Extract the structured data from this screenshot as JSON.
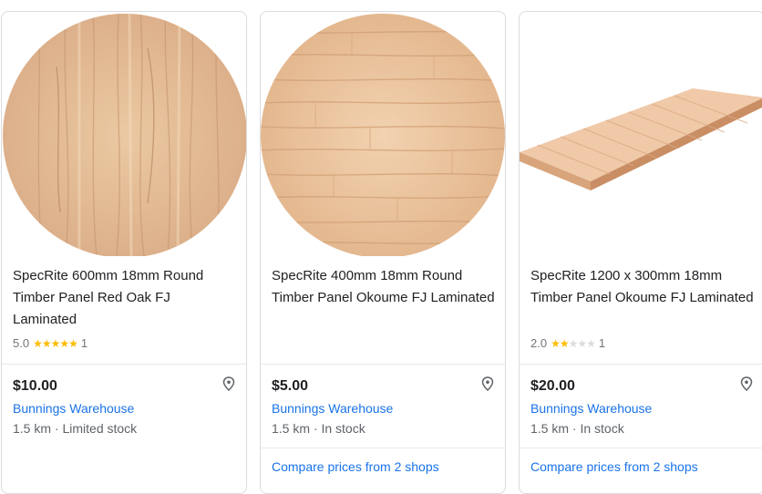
{
  "products": [
    {
      "title": "SpecRite 600mm 18mm Round Timber Panel Red Oak FJ Laminated",
      "rating": "5.0",
      "rating_value": 5,
      "review_count": "1",
      "price": "$10.00",
      "seller": "Bunnings Warehouse",
      "distance": "1.5 km",
      "stock": "Limited stock",
      "image_icon": "round-red-oak-panel"
    },
    {
      "title": "SpecRite 400mm 18mm Round Timber Panel Okoume FJ Laminated",
      "price": "$5.00",
      "seller": "Bunnings Warehouse",
      "distance": "1.5 km",
      "stock": "In stock",
      "compare": "Compare prices from 2 shops",
      "image_icon": "round-okoume-panel"
    },
    {
      "title": "SpecRite 1200 x 300mm 18mm Timber Panel Okoume FJ Laminated",
      "rating": "2.0",
      "rating_value": 2,
      "review_count": "1",
      "price": "$20.00",
      "seller": "Bunnings Warehouse",
      "distance": "1.5 km",
      "stock": "In stock",
      "compare": "Compare prices from 2 shops",
      "image_icon": "rectangular-okoume-panel"
    }
  ],
  "separator": "·",
  "colors": {
    "link": "#1a73e8",
    "star": "#fbbc04",
    "text": "#202124",
    "muted": "#5f6368"
  }
}
